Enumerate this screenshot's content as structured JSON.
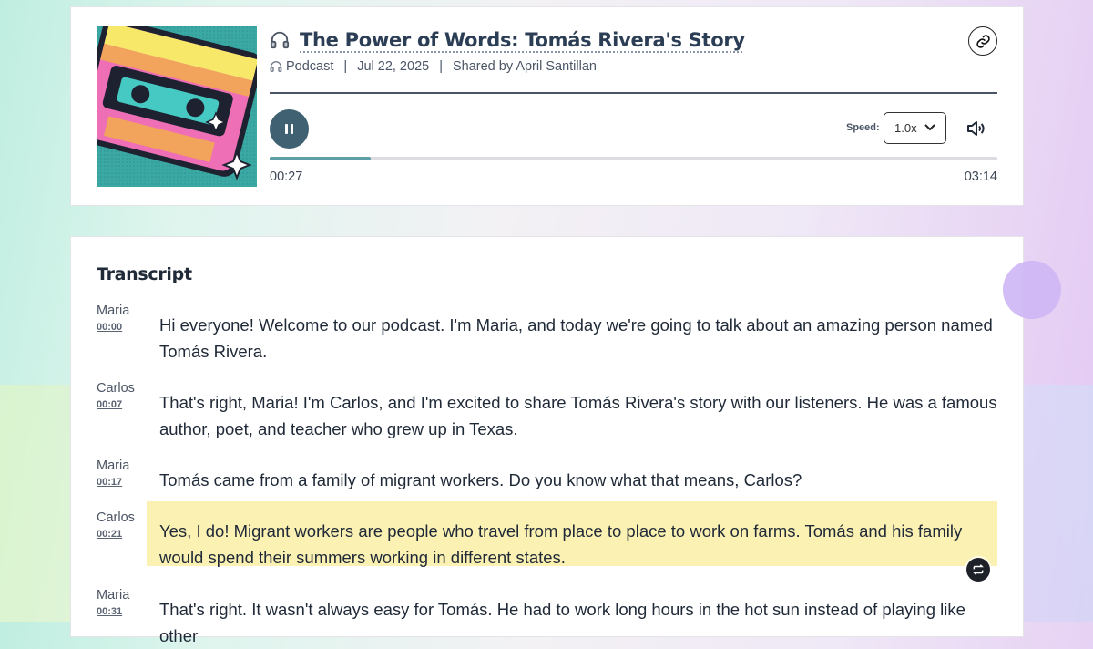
{
  "episode": {
    "title": "The Power of Words: Tomás Rivera's Story",
    "type_label": "Podcast",
    "date": "Jul 22, 2025",
    "shared_by": "Shared by April Santillan",
    "separator": "|"
  },
  "player": {
    "speed_label": "Speed:",
    "speed_value": "1.0x",
    "current_time": "00:27",
    "total_time": "03:14",
    "progress_fraction": 0.139,
    "state": "playing",
    "accent_color": "#3f6172"
  },
  "icons": {
    "link": "link-icon",
    "pause": "pause-icon",
    "volume": "volume-icon",
    "headphones": "headphones-icon",
    "chevron": "chevron-down-icon",
    "loop": "loop-icon"
  },
  "transcript": {
    "heading": "Transcript",
    "entries": [
      {
        "speaker": "Maria",
        "timestamp": "00:00",
        "text": "Hi everyone! Welcome to our podcast. I'm Maria, and today we're going to talk about an amazing person named Tomás Rivera."
      },
      {
        "speaker": "Carlos",
        "timestamp": "00:07",
        "text": "That's right, Maria! I'm Carlos, and I'm excited to share Tomás Rivera's story with our listeners. He was a famous author, poet, and teacher who grew up in Texas."
      },
      {
        "speaker": "Maria",
        "timestamp": "00:17",
        "text": "Tomás came from a family of migrant workers. Do you know what that means, Carlos?"
      },
      {
        "speaker": "Carlos",
        "timestamp": "00:21",
        "text": "Yes, I do! Migrant workers are people who travel from place to place to work on farms. Tomás and his family would spend their summers working in different states.",
        "active": true
      },
      {
        "speaker": "Maria",
        "timestamp": "00:31",
        "text": "That's right. It wasn't always easy for Tomás. He had to work long hours in the hot sun instead of playing like other"
      }
    ],
    "highlight_color": "#fbf1b3"
  }
}
